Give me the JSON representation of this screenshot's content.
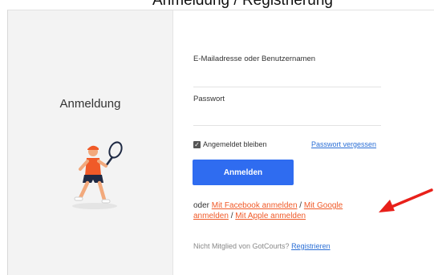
{
  "banner": {
    "text": "Anmeldung / Registrierung"
  },
  "left_panel": {
    "heading": "Anmeldung"
  },
  "form": {
    "email_label": "E-Mailadresse oder Benutzernamen",
    "password_label": "Passwort",
    "remember_label": "Angemeldet bleiben",
    "remember_checked": true,
    "forgot_link": "Passwort vergessen",
    "submit_label": "Anmelden"
  },
  "social": {
    "prefix": "oder ",
    "facebook": "Mit Facebook anmelden",
    "sep1": " / ",
    "google": "Mit Google anmelden",
    "sep2": " / ",
    "apple": "Mit Apple anmelden"
  },
  "register": {
    "text": "Nicht Mitglied von GotCourts? ",
    "link": "Registrieren"
  },
  "colors": {
    "accent_blue": "#2f6cf0",
    "link_orange": "#f05a28",
    "annotation_arrow": "#e8201a"
  },
  "icons": [
    "tennis-player-illustration",
    "checkbox-checked-icon",
    "red-arrow-annotation"
  ]
}
